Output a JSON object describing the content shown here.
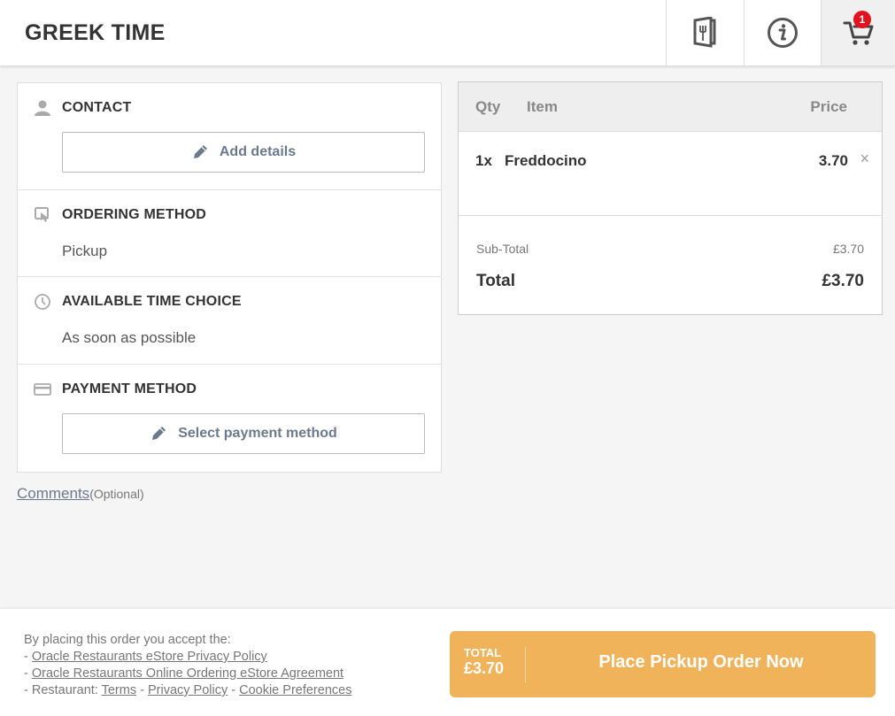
{
  "header": {
    "title": "GREEK TIME",
    "cart_count": "1"
  },
  "contact": {
    "title": "CONTACT",
    "button_label": "Add details"
  },
  "ordering_method": {
    "title": "ORDERING METHOD",
    "value": "Pickup"
  },
  "time_choice": {
    "title": "AVAILABLE TIME CHOICE",
    "value": "As soon as possible"
  },
  "payment": {
    "title": "PAYMENT METHOD",
    "button_label": "Select payment method"
  },
  "comments": {
    "link": "Comments",
    "optional": "(Optional)"
  },
  "order": {
    "headers": {
      "qty": "Qty",
      "item": "Item",
      "price": "Price"
    },
    "items": [
      {
        "qty": "1x",
        "name": "Freddocino",
        "price": "3.70",
        "remove": "×"
      }
    ],
    "subtotal_label": "Sub-Total",
    "subtotal_value": "£3.70",
    "total_label": "Total",
    "total_value": "£3.70"
  },
  "footer": {
    "intro": "By placing this order you accept the:",
    "dash": "- ",
    "privacy_policy": "Oracle Restaurants eStore Privacy Policy",
    "agreement": "Oracle Restaurants Online Ordering eStore Agreement",
    "restaurant_prefix": "- Restaurant: ",
    "terms": "Terms",
    "sep": " - ",
    "restaurant_privacy": "Privacy Policy",
    "cookies": "Cookie Preferences",
    "button_total_label": "TOTAL",
    "button_total_value": "£3.70",
    "button_label": "Place Pickup Order Now"
  },
  "colors": {
    "accent": "#f0b35a",
    "badge": "#e0131e",
    "link": "#6b7a8b"
  },
  "icons": [
    "menu-icon",
    "info-icon",
    "cart-icon",
    "person-icon",
    "touch-icon",
    "clock-icon",
    "card-icon",
    "pencil-icon"
  ]
}
